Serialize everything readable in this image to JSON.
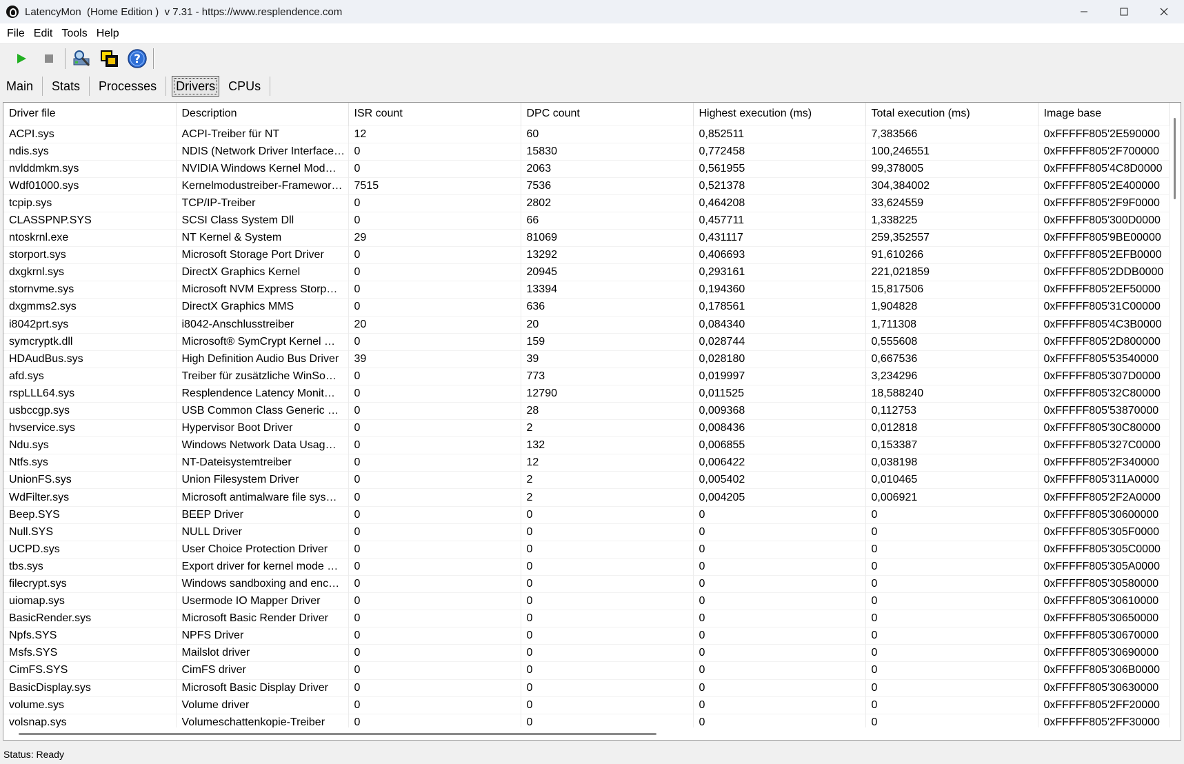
{
  "window": {
    "title": "LatencyMon  (Home Edition )  v 7.31 - https://www.resplendence.com",
    "buttons": [
      "minimize",
      "maximize",
      "close"
    ]
  },
  "menu": [
    "File",
    "Edit",
    "Tools",
    "Help"
  ],
  "toolbar": {
    "icons": [
      "play-icon",
      "stop-icon",
      "scan-icon",
      "windows-icon",
      "help-icon"
    ]
  },
  "tabs": [
    "Main",
    "Stats",
    "Processes",
    "Drivers",
    "CPUs"
  ],
  "active_tab": "Drivers",
  "table": {
    "columns": [
      "Driver file",
      "Description",
      "ISR count",
      "DPC count",
      "Highest execution (ms)",
      "Total execution (ms)",
      "Image base"
    ],
    "rows": [
      [
        "ACPI.sys",
        "ACPI-Treiber für NT",
        "12",
        "60",
        "0,852511",
        "7,383566",
        "0xFFFFF805'2E590000"
      ],
      [
        "ndis.sys",
        "NDIS (Network Driver Interface…",
        "0",
        "15830",
        "0,772458",
        "100,246551",
        "0xFFFFF805'2F700000"
      ],
      [
        "nvlddmkm.sys",
        "NVIDIA Windows Kernel Mod…",
        "0",
        "2063",
        "0,561955",
        "99,378005",
        "0xFFFFF805'4C8D0000"
      ],
      [
        "Wdf01000.sys",
        "Kernelmodustreiber-Framewor…",
        "7515",
        "7536",
        "0,521378",
        "304,384002",
        "0xFFFFF805'2E400000"
      ],
      [
        "tcpip.sys",
        "TCP/IP-Treiber",
        "0",
        "2802",
        "0,464208",
        "33,624559",
        "0xFFFFF805'2F9F0000"
      ],
      [
        "CLASSPNP.SYS",
        "SCSI Class System Dll",
        "0",
        "66",
        "0,457711",
        "1,338225",
        "0xFFFFF805'300D0000"
      ],
      [
        "ntoskrnl.exe",
        "NT Kernel & System",
        "29",
        "81069",
        "0,431117",
        "259,352557",
        "0xFFFFF805'9BE00000"
      ],
      [
        "storport.sys",
        "Microsoft Storage Port Driver",
        "0",
        "13292",
        "0,406693",
        "91,610266",
        "0xFFFFF805'2EFB0000"
      ],
      [
        "dxgkrnl.sys",
        "DirectX Graphics Kernel",
        "0",
        "20945",
        "0,293161",
        "221,021859",
        "0xFFFFF805'2DDB0000"
      ],
      [
        "stornvme.sys",
        "Microsoft NVM Express Storp…",
        "0",
        "13394",
        "0,194360",
        "15,817506",
        "0xFFFFF805'2EF50000"
      ],
      [
        "dxgmms2.sys",
        "DirectX Graphics MMS",
        "0",
        "636",
        "0,178561",
        "1,904828",
        "0xFFFFF805'31C00000"
      ],
      [
        "i8042prt.sys",
        "i8042-Anschlusstreiber",
        "20",
        "20",
        "0,084340",
        "1,711308",
        "0xFFFFF805'4C3B0000"
      ],
      [
        "symcryptk.dll",
        "Microsoft® SymCrypt Kernel …",
        "0",
        "159",
        "0,028744",
        "0,555608",
        "0xFFFFF805'2D800000"
      ],
      [
        "HDAudBus.sys",
        "High Definition Audio Bus Driver",
        "39",
        "39",
        "0,028180",
        "0,667536",
        "0xFFFFF805'53540000"
      ],
      [
        "afd.sys",
        "Treiber für zusätzliche WinSo…",
        "0",
        "773",
        "0,019997",
        "3,234296",
        "0xFFFFF805'307D0000"
      ],
      [
        "rspLLL64.sys",
        "Resplendence Latency Monit…",
        "0",
        "12790",
        "0,011525",
        "18,588240",
        "0xFFFFF805'32C80000"
      ],
      [
        "usbccgp.sys",
        "USB Common Class Generic …",
        "0",
        "28",
        "0,009368",
        "0,112753",
        "0xFFFFF805'53870000"
      ],
      [
        "hvservice.sys",
        "Hypervisor Boot Driver",
        "0",
        "2",
        "0,008436",
        "0,012818",
        "0xFFFFF805'30C80000"
      ],
      [
        "Ndu.sys",
        "Windows Network Data Usag…",
        "0",
        "132",
        "0,006855",
        "0,153387",
        "0xFFFFF805'327C0000"
      ],
      [
        "Ntfs.sys",
        "NT-Dateisystemtreiber",
        "0",
        "12",
        "0,006422",
        "0,038198",
        "0xFFFFF805'2F340000"
      ],
      [
        "UnionFS.sys",
        "Union Filesystem Driver",
        "0",
        "2",
        "0,005402",
        "0,010465",
        "0xFFFFF805'311A0000"
      ],
      [
        "WdFilter.sys",
        "Microsoft antimalware file sys…",
        "0",
        "2",
        "0,004205",
        "0,006921",
        "0xFFFFF805'2F2A0000"
      ],
      [
        "Beep.SYS",
        "BEEP Driver",
        "0",
        "0",
        "0",
        "0",
        "0xFFFFF805'30600000"
      ],
      [
        "Null.SYS",
        "NULL Driver",
        "0",
        "0",
        "0",
        "0",
        "0xFFFFF805'305F0000"
      ],
      [
        "UCPD.sys",
        "User Choice Protection Driver",
        "0",
        "0",
        "0",
        "0",
        "0xFFFFF805'305C0000"
      ],
      [
        "tbs.sys",
        "Export driver for kernel mode …",
        "0",
        "0",
        "0",
        "0",
        "0xFFFFF805'305A0000"
      ],
      [
        "filecrypt.sys",
        "Windows sandboxing and enc…",
        "0",
        "0",
        "0",
        "0",
        "0xFFFFF805'30580000"
      ],
      [
        "uiomap.sys",
        "Usermode IO Mapper Driver",
        "0",
        "0",
        "0",
        "0",
        "0xFFFFF805'30610000"
      ],
      [
        "BasicRender.sys",
        "Microsoft Basic Render Driver",
        "0",
        "0",
        "0",
        "0",
        "0xFFFFF805'30650000"
      ],
      [
        "Npfs.SYS",
        "NPFS Driver",
        "0",
        "0",
        "0",
        "0",
        "0xFFFFF805'30670000"
      ],
      [
        "Msfs.SYS",
        "Mailslot driver",
        "0",
        "0",
        "0",
        "0",
        "0xFFFFF805'30690000"
      ],
      [
        "CimFS.SYS",
        "CimFS driver",
        "0",
        "0",
        "0",
        "0",
        "0xFFFFF805'306B0000"
      ],
      [
        "BasicDisplay.sys",
        "Microsoft Basic Display Driver",
        "0",
        "0",
        "0",
        "0",
        "0xFFFFF805'30630000"
      ],
      [
        "volume.sys",
        "Volume driver",
        "0",
        "0",
        "0",
        "0",
        "0xFFFFF805'2FF20000"
      ],
      [
        "volsnap.sys",
        "Volumeschattenkopie-Treiber",
        "0",
        "0",
        "0",
        "0",
        "0xFFFFF805'2FF30000"
      ]
    ]
  },
  "status": "Status: Ready",
  "colors": {
    "play": "#22b022",
    "stop": "#8c8c8c",
    "help": "#2f6fd6",
    "titlebar": "#eef1f6"
  }
}
